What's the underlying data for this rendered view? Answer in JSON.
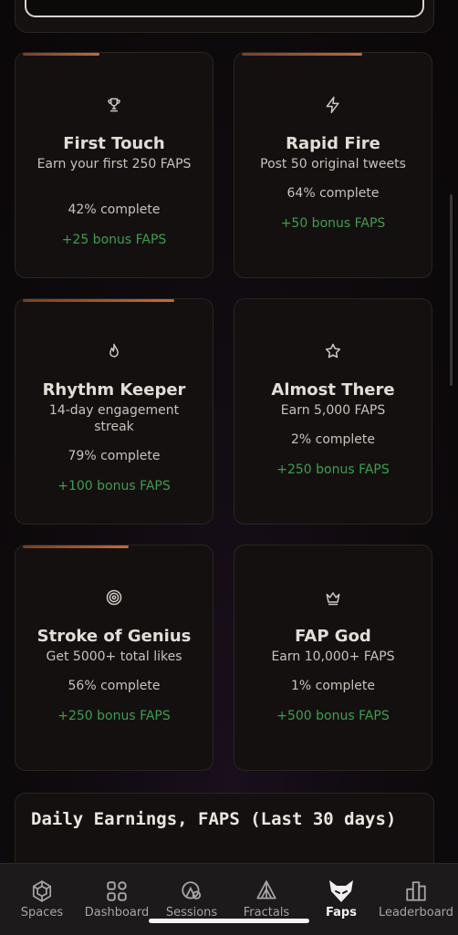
{
  "achievements": [
    {
      "icon": "trophy-icon",
      "title": "First Touch",
      "desc": "Earn your first 250 FAPS",
      "progress_pct": 42,
      "complete_text": "42% complete",
      "bonus": "+25 bonus FAPS"
    },
    {
      "icon": "lightning-icon",
      "title": "Rapid Fire",
      "desc": "Post 50 original tweets",
      "progress_pct": 64,
      "complete_text": "64% complete",
      "bonus": "+50 bonus FAPS"
    },
    {
      "icon": "flame-icon",
      "title": "Rhythm Keeper",
      "desc": "14-day engagement streak",
      "progress_pct": 79,
      "complete_text": "79% complete",
      "bonus": "+100 bonus FAPS"
    },
    {
      "icon": "star-icon",
      "title": "Almost There",
      "desc": "Earn 5,000 FAPS",
      "progress_pct": 2,
      "complete_text": "2% complete",
      "bonus": "+250 bonus FAPS"
    },
    {
      "icon": "target-icon",
      "title": "Stroke of Genius",
      "desc": "Get 5000+ total likes",
      "progress_pct": 56,
      "complete_text": "56% complete",
      "bonus": "+250 bonus FAPS"
    },
    {
      "icon": "crown-icon",
      "title": "FAP God",
      "desc": "Earn 10,000+ FAPS",
      "progress_pct": 1,
      "complete_text": "1% complete",
      "bonus": "+500 bonus FAPS"
    }
  ],
  "daily": {
    "title": "Daily Earnings, FAPS (Last 30 days)"
  },
  "nav": [
    {
      "icon": "spaces-icon",
      "label": "Spaces",
      "active": false
    },
    {
      "icon": "dashboard-icon",
      "label": "Dashboard",
      "active": false
    },
    {
      "icon": "sessions-icon",
      "label": "Sessions",
      "active": false
    },
    {
      "icon": "fractals-icon",
      "label": "Fractals",
      "active": false
    },
    {
      "icon": "faps-icon",
      "label": "Faps",
      "active": true
    },
    {
      "icon": "leaderboard-icon",
      "label": "Leaderboard",
      "active": false
    }
  ],
  "colors": {
    "progress": "#c46a3a",
    "bonus": "#3f9d4e",
    "card_bg": "#141010"
  }
}
